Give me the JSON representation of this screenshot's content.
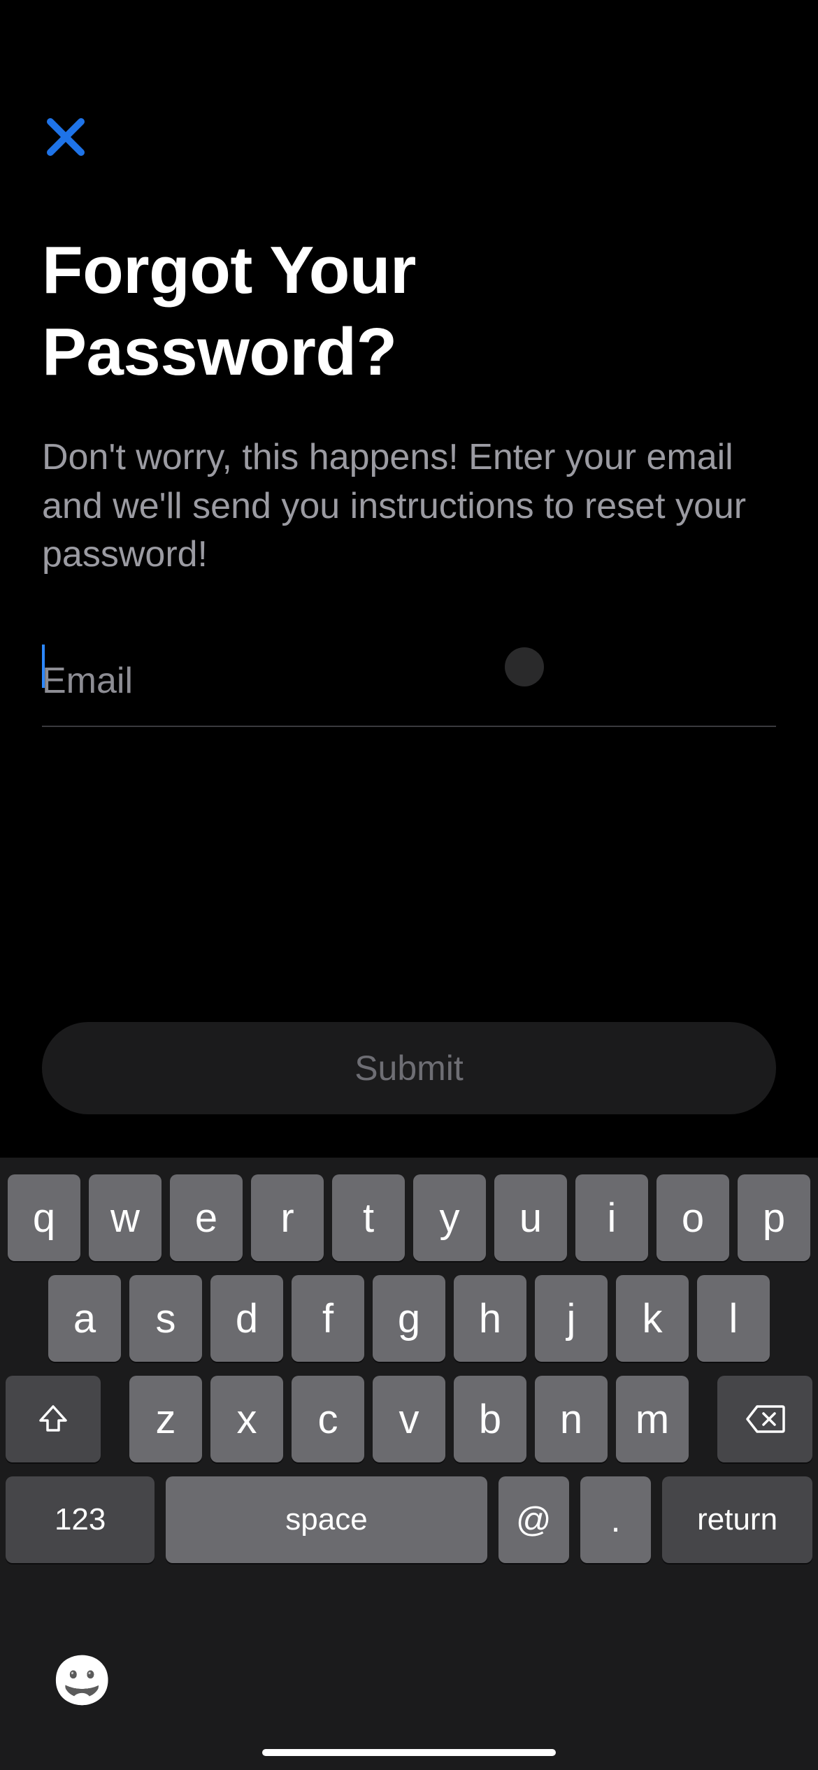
{
  "header": {
    "close_icon": "close-icon"
  },
  "main": {
    "title": "Forgot Your Password?",
    "subtitle": "Don't worry, this happens! Enter your email and we'll send you instructions to reset your password!",
    "email_placeholder": "Email",
    "email_value": "",
    "submit_label": "Submit"
  },
  "keyboard": {
    "row1": [
      "q",
      "w",
      "e",
      "r",
      "t",
      "y",
      "u",
      "i",
      "o",
      "p"
    ],
    "row2": [
      "a",
      "s",
      "d",
      "f",
      "g",
      "h",
      "j",
      "k",
      "l"
    ],
    "row3": [
      "z",
      "x",
      "c",
      "v",
      "b",
      "n",
      "m"
    ],
    "shift_icon": "shift-icon",
    "backspace_icon": "backspace-icon",
    "numbers_label": "123",
    "space_label": "space",
    "at_label": "@",
    "dot_label": ".",
    "return_label": "return",
    "emoji_icon": "emoji-icon"
  },
  "colors": {
    "accent": "#2d88ff",
    "bg": "#000000",
    "key": "#6b6b6f",
    "key_fn": "#464649",
    "text_muted": "#9b9ba2"
  }
}
